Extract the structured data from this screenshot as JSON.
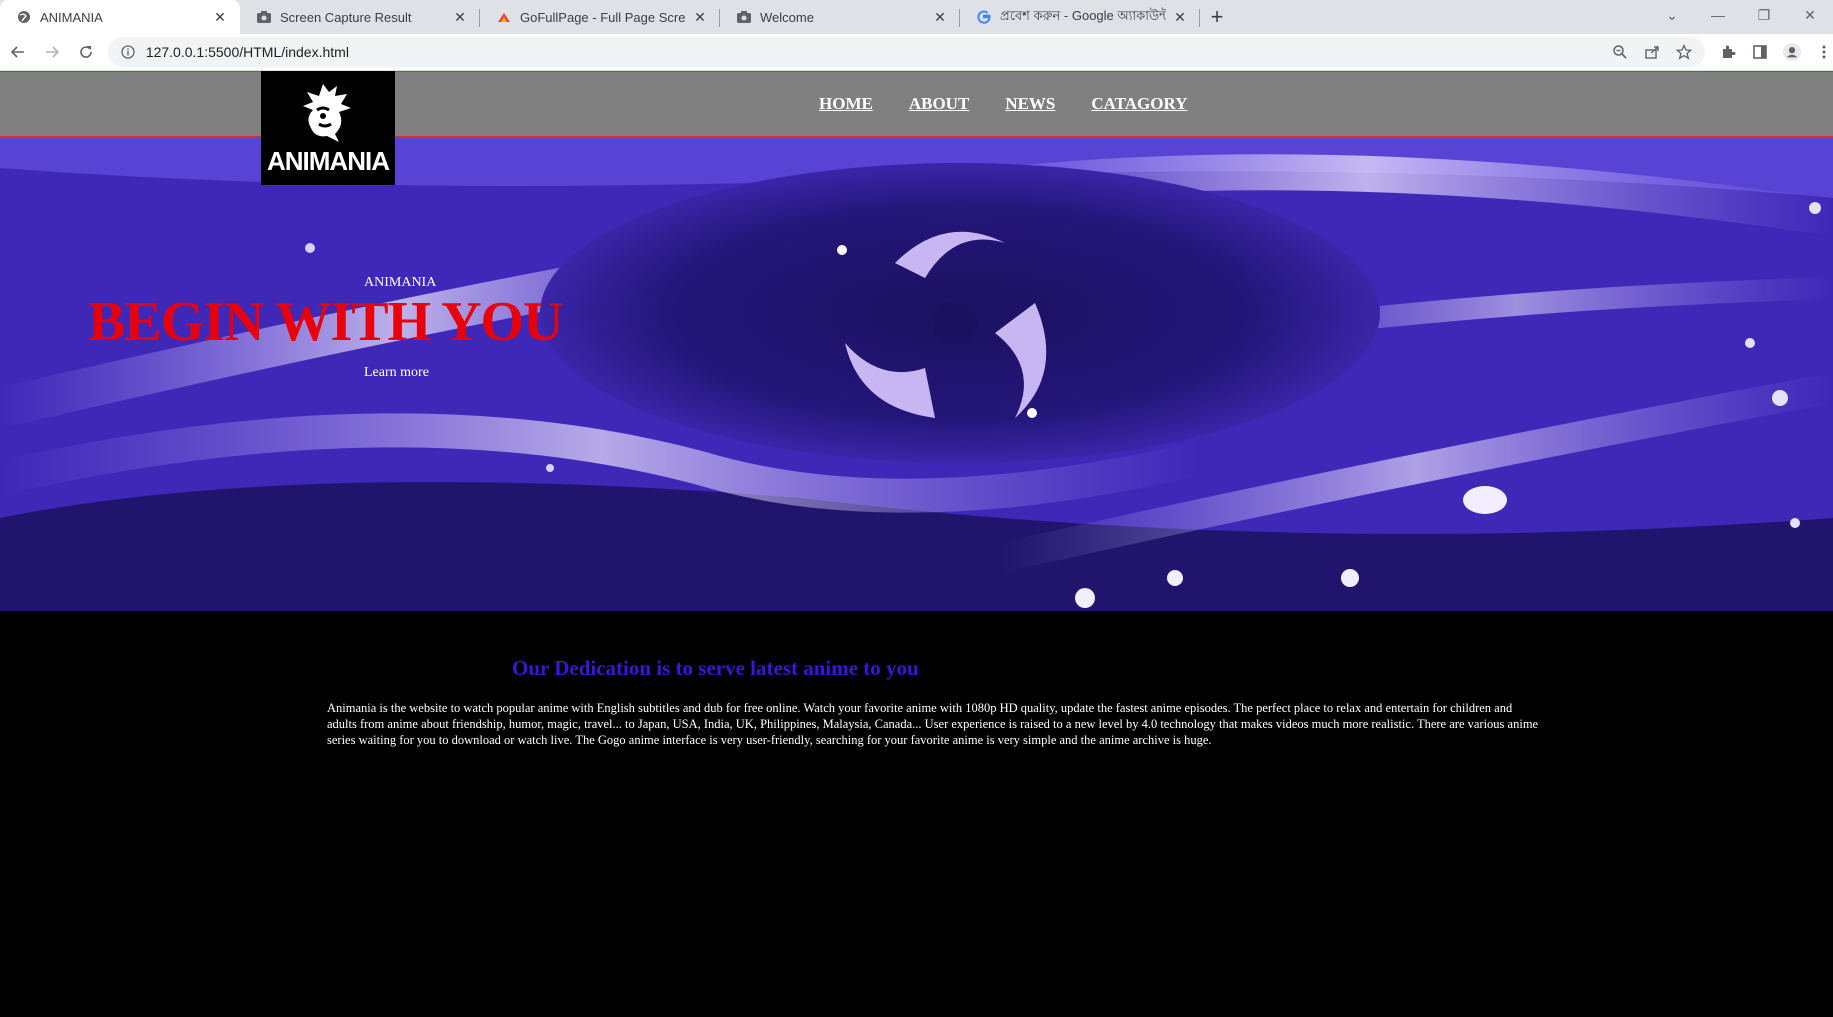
{
  "browser": {
    "tabs": [
      {
        "title": "ANIMANIA",
        "active": true,
        "icon": "globe-icon"
      },
      {
        "title": "Screen Capture Result",
        "active": false,
        "icon": "camera-icon"
      },
      {
        "title": "GoFullPage - Full Page Screen Ca",
        "active": false,
        "icon": "gofullpage-icon"
      },
      {
        "title": "Welcome",
        "active": false,
        "icon": "camera-icon"
      },
      {
        "title": "প্রবেশ করুন - Google অ্যাকাউন্ট",
        "active": false,
        "icon": "google-icon"
      }
    ],
    "address": "127.0.0.1:5500/HTML/index.html"
  },
  "site": {
    "logo_text": "ANIMANIA",
    "nav": [
      "HOME",
      "ABOUT",
      "NEWS",
      "CATAGORY"
    ],
    "hero": {
      "kicker": "ANIMANIA",
      "title": "BEGIN WITH YOU",
      "link": "Learn more"
    },
    "section": {
      "heading": "Our Dedication is to serve latest anime to you",
      "body": "Animania is the website to watch popular anime with English subtitles and dub for free online. Watch your favorite anime with 1080p HD quality, update the fastest anime episodes. The perfect place to relax and entertain for children and adults from anime about friendship, humor, magic, travel... to Japan, USA, India, UK, Philippines, Malaysia, Canada... User experience is raised to a new level by 4.0 technology that makes videos much more realistic. There are various anime series waiting for you to download or watch live. The Gogo anime interface is very user-friendly, searching for your favorite anime is very simple and the anime archive is huge."
    }
  },
  "colors": {
    "nav_bg": "#808080",
    "nav_border": "#d93025",
    "hero_title": "#e8000b",
    "heading": "#3a17d6"
  }
}
